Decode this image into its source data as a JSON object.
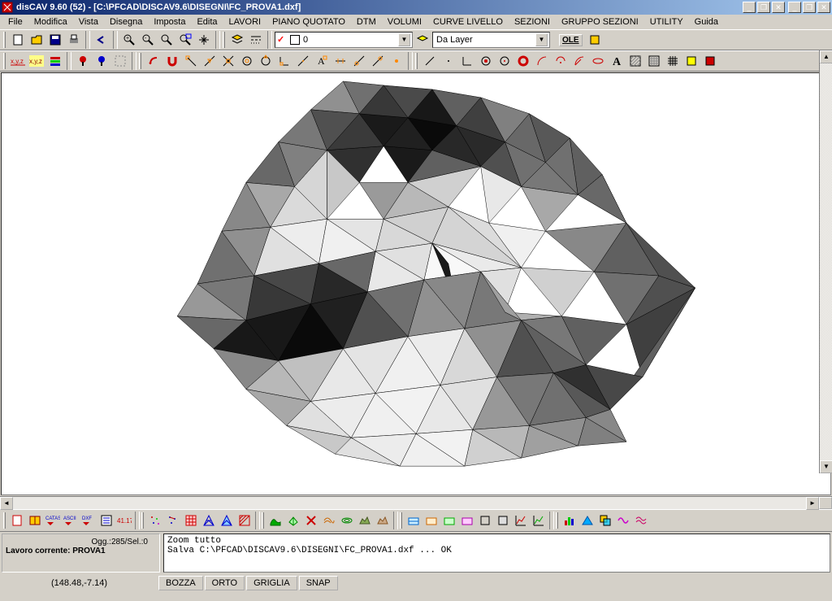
{
  "app": {
    "title": "disCAV 9.60 (52) - [C:\\PFCAD\\DISCAV9.6\\DISEGNI\\FC_PROVA1.dxf]"
  },
  "menu": [
    "File",
    "Modifica",
    "Vista",
    "Disegna",
    "Imposta",
    "Edita",
    "LAVORI",
    "PIANO QUOTATO",
    "DTM",
    "VOLUMI",
    "CURVE LIVELLO",
    "SEZIONI",
    "GRUPPO SEZIONI",
    "UTILITY",
    "Guida"
  ],
  "layer_combo": {
    "value": "0"
  },
  "style_combo": {
    "value": "Da Layer"
  },
  "ole_label": "OLE",
  "status": {
    "ogg": "Ogg.:285/Sel.:0",
    "lavoro": "Lavoro corrente: PROVA1"
  },
  "console": "Zoom tutto\nSalva C:\\PFCAD\\DISCAV9.6\\DISEGNI\\FC_PROVA1.dxf ... OK",
  "coords": "(148.48,-7.14)",
  "modes": [
    "BOZZA",
    "ORTO",
    "GRIGLIA",
    "SNAP"
  ],
  "win_buttons": {
    "min": "_",
    "max": "❐",
    "close": "✕"
  },
  "toolbar1_icons": [
    "new-file",
    "open-file",
    "save-file",
    "print",
    "undo",
    "zoom-in",
    "zoom-out",
    "zoom-window",
    "zoom-extents",
    "pan"
  ],
  "toolbar1b_icons": [
    "layers",
    "line-style"
  ],
  "toolbar2_left_icons": [
    "xyz-red",
    "xyz-yellow",
    "stack-1",
    "stack-2",
    "flag-red",
    "flag-blue",
    "box-dash"
  ],
  "toolbar2_right_icons": [
    "arrow-back",
    "magnet",
    "circle-1",
    "circle-2",
    "circle-3",
    "target",
    "cross",
    "perpendicular",
    "ray",
    "text-A",
    "dimension",
    "node-1",
    "node-2",
    "dot"
  ],
  "toolbar2_far_icons": [
    "diag-line",
    "blank",
    "angle",
    "target-red",
    "dot-red",
    "donut",
    "arc-1",
    "arc-2",
    "arc-3",
    "ellipse",
    "letter-A",
    "hatch",
    "hatch-2",
    "grid",
    "box-yellow",
    "box-red"
  ],
  "bottom_toolbar_icons": [
    "doc",
    "book",
    "catast",
    "ascii-export",
    "dxf-export",
    "list",
    "num-417",
    "sep",
    "scatter-1",
    "scatter-2",
    "grid-red",
    "mesh",
    "mesh-fill",
    "hatch-red",
    "sep",
    "green-1",
    "mesh-3d",
    "cross-red",
    "curve-1",
    "curve-2",
    "terrain-1",
    "terrain-2",
    "sep",
    "section-1",
    "section-2",
    "section-3",
    "section-4",
    "box-1",
    "box-2",
    "graph-1",
    "graph-2",
    "sep",
    "bars",
    "triangle-blue",
    "overlay",
    "wave-pink",
    "wave-2"
  ]
}
